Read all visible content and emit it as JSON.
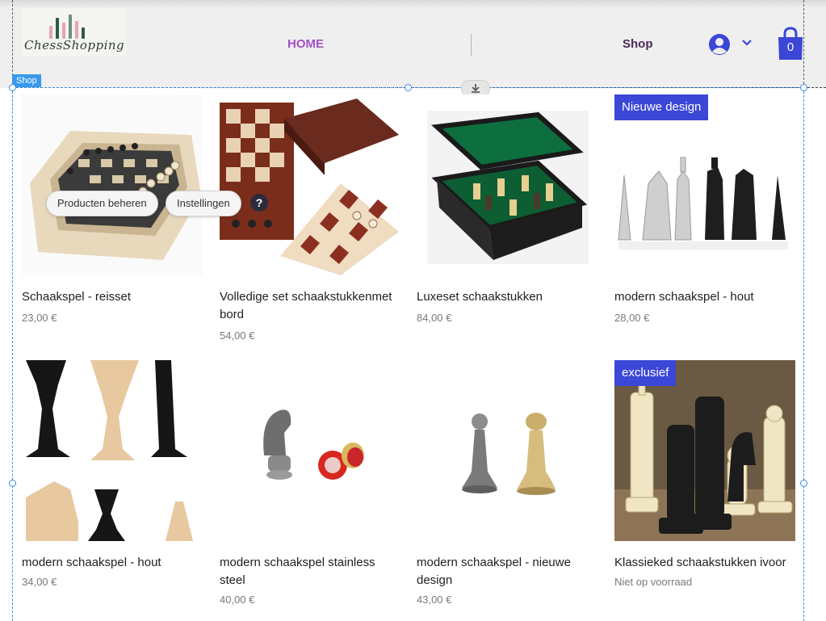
{
  "header": {
    "logo_text": "ChessShopping",
    "nav_home": "HOME",
    "nav_shop": "Shop",
    "cart_count": "0"
  },
  "editor": {
    "section_tag": "Shop",
    "manage_products": "Producten beheren",
    "settings": "Instellingen",
    "help": "?"
  },
  "products": [
    {
      "name": "Schaakspel - reisset",
      "price": "23,00 €",
      "ribbon": ""
    },
    {
      "name": "Volledige set schaakstukkenmet bord",
      "price": "54,00 €",
      "ribbon": ""
    },
    {
      "name": "Luxeset schaakstukken",
      "price": "84,00 €",
      "ribbon": ""
    },
    {
      "name": "modern schaakspel - hout",
      "price": "28,00 €",
      "ribbon": "Nieuwe design"
    },
    {
      "name": "modern schaakspel - hout",
      "price": "34,00 €",
      "ribbon": ""
    },
    {
      "name": "modern schaakspel stainless steel",
      "price": "40,00 €",
      "ribbon": ""
    },
    {
      "name": "modern schaakspel - nieuwe design",
      "price": "43,00 €",
      "ribbon": ""
    },
    {
      "name": "Klassieked schaakstukken ivoor",
      "price": "Niet op voorraad",
      "ribbon": "exclusief"
    }
  ],
  "colors": {
    "accent_nav": "#a34fc7",
    "ribbon": "#3b47d6",
    "cart": "#3b47d6",
    "editor_selection": "#3899ec"
  }
}
